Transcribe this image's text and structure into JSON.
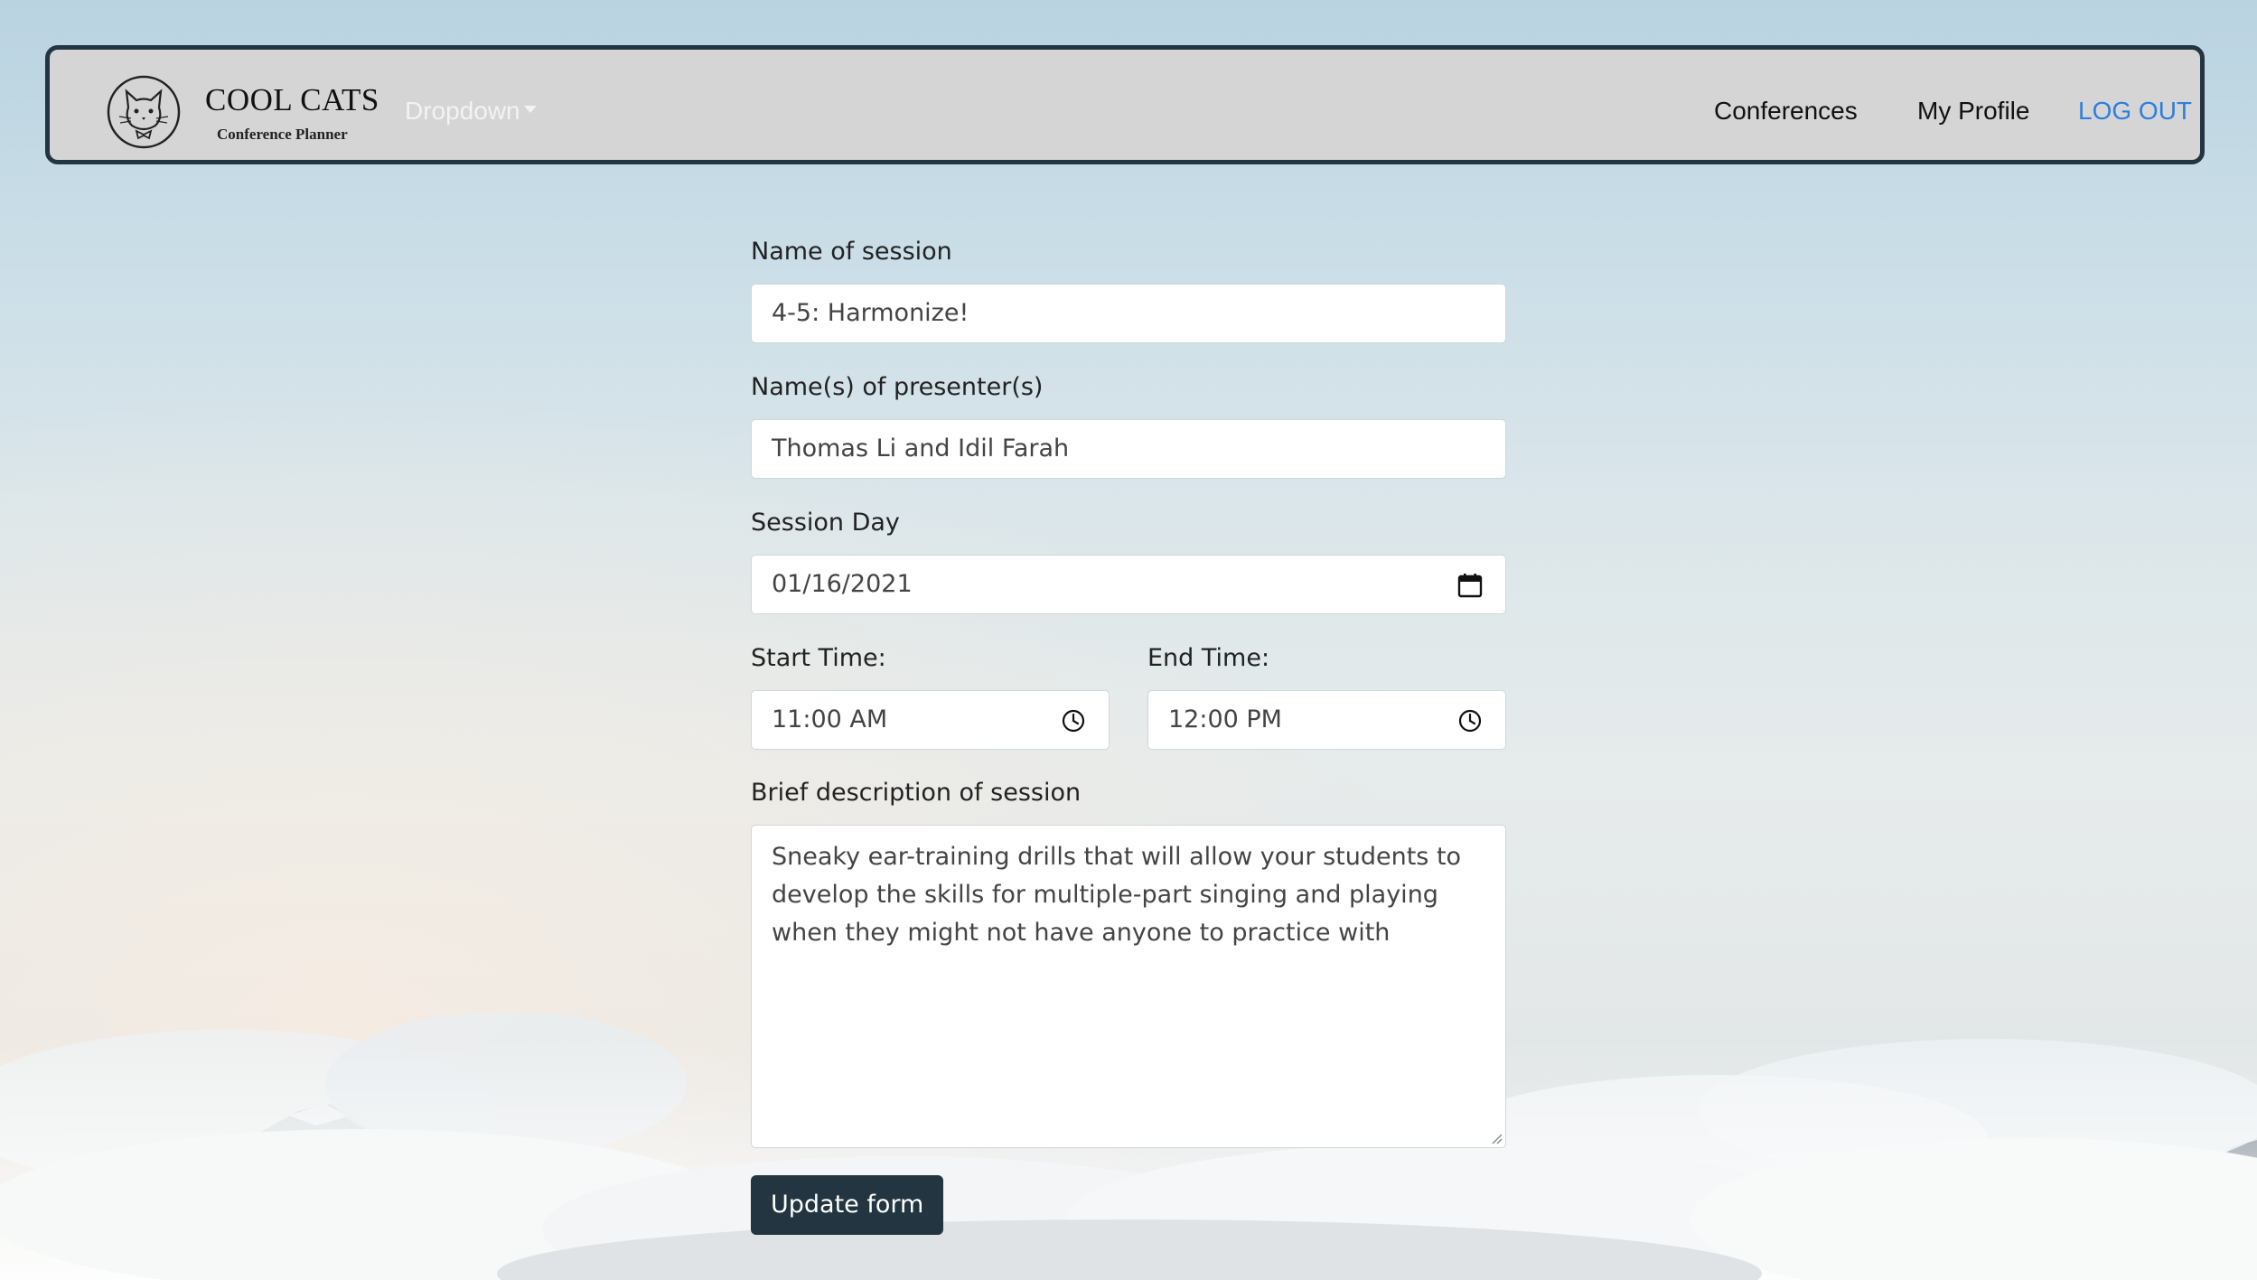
{
  "navbar": {
    "brand_title": "COOL CATS",
    "brand_subtitle": "Conference Planner",
    "dropdown_label": "Dropdown",
    "links": {
      "conferences": "Conferences",
      "my_profile": "My Profile",
      "log_out": "LOG OUT"
    },
    "logout_color": "#2a7fe0",
    "border_color": "#223540"
  },
  "form": {
    "session_name": {
      "label": "Name of session",
      "value": "4-5: Harmonize!"
    },
    "presenters": {
      "label": "Name(s) of presenter(s)",
      "value": "Thomas Li and Idil Farah"
    },
    "session_day": {
      "label": "Session Day",
      "value": "01/16/2021",
      "icon": "calendar-icon"
    },
    "start_time": {
      "label": "Start Time:",
      "value": "11:00 AM",
      "icon": "clock-icon"
    },
    "end_time": {
      "label": "End Time:",
      "value": "12:00 PM",
      "icon": "clock-icon"
    },
    "description": {
      "label": "Brief description of session",
      "value": "Sneaky ear-training drills that will allow your students to develop the skills for multiple-part singing and playing when they might not have anyone to practice with"
    },
    "submit_label": "Update form",
    "submit_color": "#223540"
  }
}
